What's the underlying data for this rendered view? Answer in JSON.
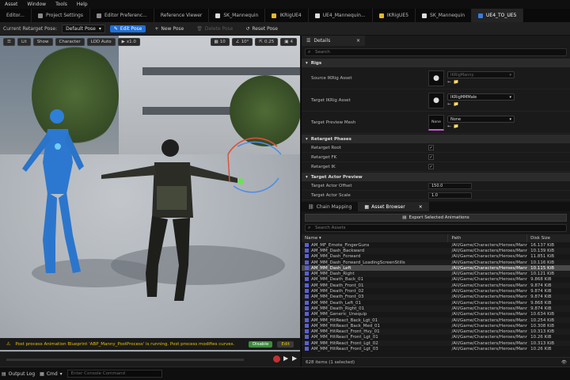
{
  "menu": [
    "Asset",
    "Window",
    "Tools",
    "Help"
  ],
  "tabs": [
    {
      "label": "Editor...",
      "color": "#9a9a9a"
    },
    {
      "label": "Project Settings",
      "color": "#9a9a9a"
    },
    {
      "label": "Editor Preferenc...",
      "color": "#9a9a9a"
    },
    {
      "label": "Reference Viewer",
      "color": "#9a9a9a"
    },
    {
      "label": "SK_Mannequin",
      "color": "#e0e0e0"
    },
    {
      "label": "IKRigUE4",
      "color": "#e8b828"
    },
    {
      "label": "UE4_Mannequin...",
      "color": "#e0e0e0"
    },
    {
      "label": "IKRigUE5",
      "color": "#e8b828"
    },
    {
      "label": "SK_Mannequin",
      "color": "#e0e0e0"
    },
    {
      "label": "UE4_TO_UE5",
      "color": "#3a7be0"
    }
  ],
  "toolbar": {
    "retarget_pose_label": "Current Retarget Pose:",
    "retarget_pose_value": "Default Pose",
    "edit_pose": "Edit Pose",
    "new_pose": "New Pose",
    "delete_pose": "Delete Pose",
    "reset_pose": "Reset Pose"
  },
  "viewport": {
    "buttons": [
      "Lit",
      "Show",
      "Character",
      "LOD Auto",
      "x1.0"
    ],
    "snap_values": [
      "10",
      "10°",
      "0.25",
      "4"
    ],
    "warning": "Post process Animation Blueprint 'ABP_Manny_PostProcess' is running. Post process modifies curves.",
    "disable": "Disable",
    "edit": "Edit"
  },
  "details": {
    "tab": "Details",
    "search_placeholder": "Search",
    "sections": {
      "rigs": "Rigs",
      "phases": "Retarget Phases",
      "preview": "Target Actor Preview"
    },
    "source_ik_label": "Source IKRig Asset",
    "source_ik_value": "IKRigManny",
    "target_ik_label": "Target IKRig Asset",
    "target_ik_value": "IKRigMMMale",
    "preview_mesh_label": "Target Preview Mesh",
    "preview_mesh_thumb": "None",
    "preview_mesh_value": "None",
    "root_label": "Retarget Root",
    "fk_label": "Retarget FK",
    "ik_label": "Retarget IK",
    "offset_label": "Target Actor Offset",
    "offset_value": "150.0",
    "scale_label": "Target Actor Scale",
    "scale_value": "1.0"
  },
  "browser": {
    "tabs": [
      "Chain Mapping",
      "Asset Browser"
    ],
    "export_button": "Export Selected Animations",
    "search_placeholder": "Search Assets",
    "columns": [
      "Name",
      "Path",
      "Disk Size"
    ],
    "path": "/All/Game/Characters/Heroes/Mann",
    "rows": [
      {
        "name": "AM_MF_Emote_FingerGuns",
        "size": "16.137 KiB"
      },
      {
        "name": "AM_MM_Dash_Backward",
        "size": "10.139 KiB"
      },
      {
        "name": "AM_MM_Dash_Forward",
        "size": "11.851 KiB"
      },
      {
        "name": "AM_MM_Dash_Forward_LoadingScreenStills",
        "size": "10.116 KiB"
      },
      {
        "name": "AM_MM_Dash_Left",
        "size": "10.115 KiB"
      },
      {
        "name": "AM_MM_Dash_Right",
        "size": "10.121 KiB"
      },
      {
        "name": "AM_MM_Death_Back_01",
        "size": "9.868 KiB"
      },
      {
        "name": "AM_MM_Death_Front_01",
        "size": "9.874 KiB"
      },
      {
        "name": "AM_MM_Death_Front_02",
        "size": "9.874 KiB"
      },
      {
        "name": "AM_MM_Death_Front_03",
        "size": "9.874 KiB"
      },
      {
        "name": "AM_MM_Death_Left_01",
        "size": "9.868 KiB"
      },
      {
        "name": "AM_MM_Death_Right_01",
        "size": "9.874 KiB"
      },
      {
        "name": "AM_MM_Generic_Unequip",
        "size": "10.634 KiB"
      },
      {
        "name": "AM_MM_HitReact_Back_Lgt_01",
        "size": "10.254 KiB"
      },
      {
        "name": "AM_MM_HitReact_Back_Med_01",
        "size": "10.308 KiB"
      },
      {
        "name": "AM_MM_HitReact_Front_Hvy_01",
        "size": "10.313 KiB"
      },
      {
        "name": "AM_MM_HitReact_Front_Lgt_01",
        "size": "10.26 KiB"
      },
      {
        "name": "AM_MM_HitReact_Front_Lgt_02",
        "size": "10.313 KiB"
      },
      {
        "name": "AM_MM_HitReact_Front_Lgt_03",
        "size": "10.26 KiB"
      }
    ],
    "footer": "628 items (1 selected)"
  },
  "status": {
    "output_log": "Output Log",
    "cmd": "Cmd",
    "console_placeholder": "Enter Console Command"
  }
}
